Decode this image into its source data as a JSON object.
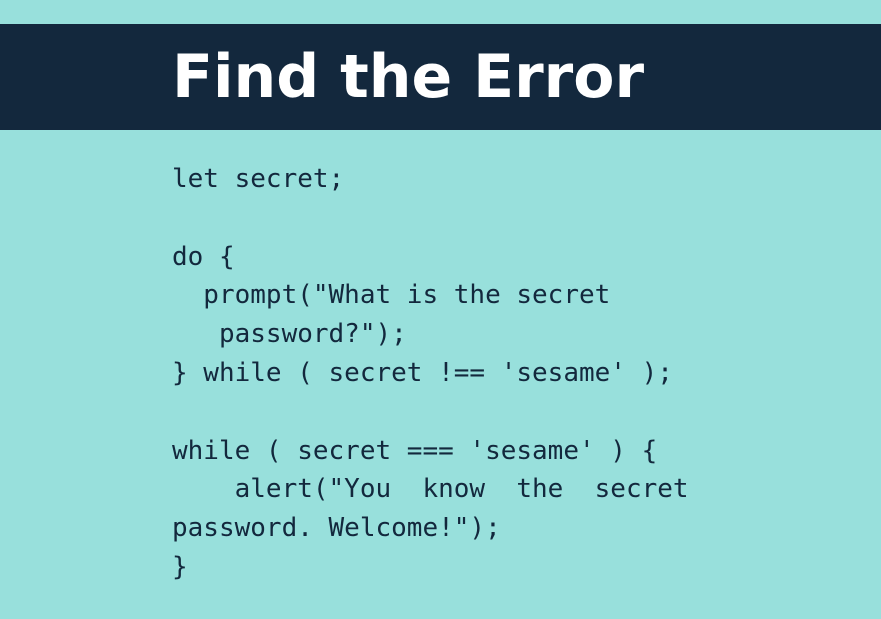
{
  "header": {
    "title": "Find the Error"
  },
  "code": {
    "lines": [
      "let secret;",
      "",
      "do {",
      "  prompt(\"What is the secret",
      "   password?\");",
      "} while ( secret !== 'sesame' );",
      "",
      "while ( secret === 'sesame' ) {",
      "    alert(\"You  know  the  secret",
      "password. Welcome!\");",
      "}"
    ]
  },
  "colors": {
    "background": "#98e0dc",
    "header_background": "#13283d",
    "title_text": "#ffffff",
    "code_text": "#13283d"
  }
}
